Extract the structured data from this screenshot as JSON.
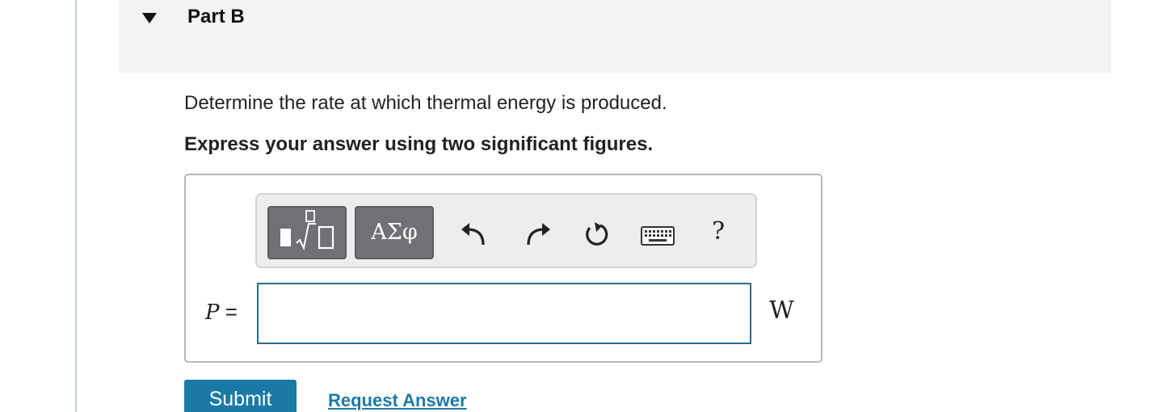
{
  "part": {
    "title": "Part B"
  },
  "question": {
    "prompt": "Determine the rate at which thermal energy is produced.",
    "instruction": "Express your answer using two significant figures."
  },
  "toolbar": {
    "templates_icon": "math-templates-icon",
    "greek_label": "ΑΣφ",
    "undo_icon": "undo-arrow-icon",
    "redo_icon": "redo-arrow-icon",
    "reset_icon": "reset-circular-arrow-icon",
    "keyboard_icon": "keyboard-icon",
    "help_label": "?"
  },
  "answer": {
    "variable": "P",
    "equals": "=",
    "value": "",
    "unit": "W"
  },
  "actions": {
    "submit_label": "Submit",
    "request_label": "Request Answer"
  },
  "colors": {
    "accent": "#1b7aa5",
    "input_border": "#2b6a8f",
    "toolbar_button": "#6f7174",
    "header_bg": "#f3f3f3"
  }
}
